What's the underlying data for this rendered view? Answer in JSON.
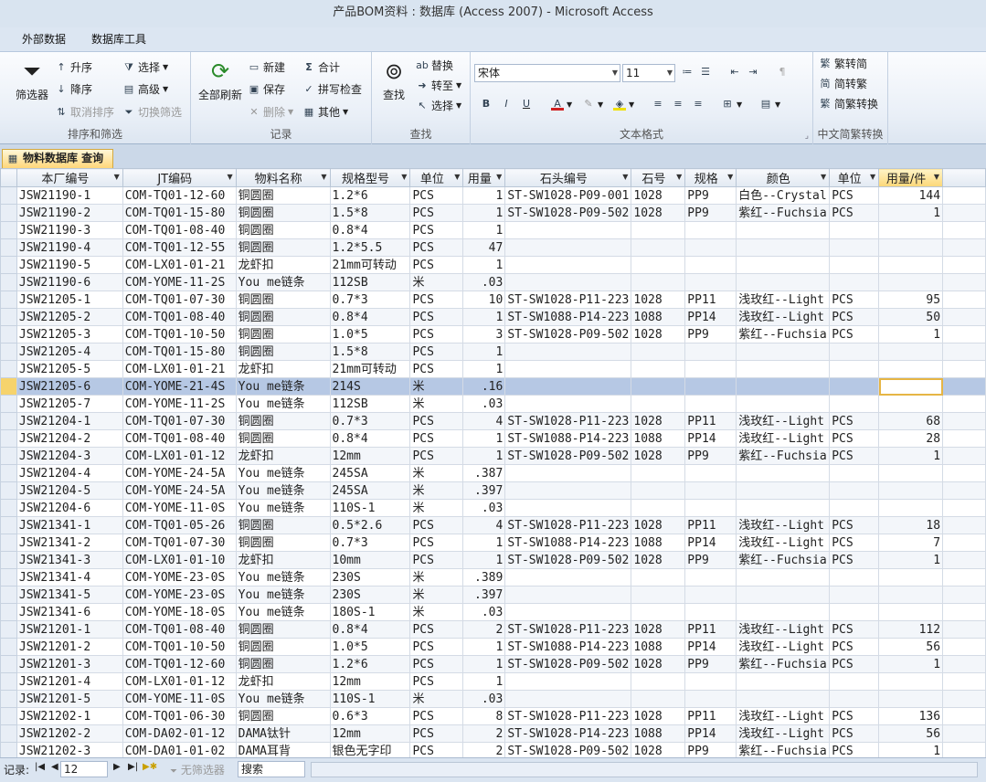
{
  "window": {
    "title": "产品BOM资料 : 数据库 (Access 2007)  -  Microsoft Access"
  },
  "ribbon_tabs": [
    "外部数据",
    "数据库工具"
  ],
  "ribbon": {
    "sort_filter": {
      "label": "排序和筛选",
      "filter": "筛选器",
      "asc": "升序",
      "desc": "降序",
      "clear_sort": "取消排序",
      "select": "选择",
      "advanced": "高级",
      "toggle_filter": "切换筛选"
    },
    "records": {
      "label": "记录",
      "refresh_all": "全部刷新",
      "new": "新建",
      "save": "保存",
      "delete": "删除",
      "totals": "合计",
      "spelling": "拼写检查",
      "more": "其他"
    },
    "find": {
      "label": "查找",
      "find": "查找",
      "replace": "替换",
      "goto": "转至",
      "select": "选择"
    },
    "text_format": {
      "label": "文本格式",
      "font": "宋体",
      "size": "11"
    },
    "chinese": {
      "label": "中文简繁转换",
      "t2s": "繁转简",
      "s2t": "简转繁",
      "convert": "简繁转换"
    }
  },
  "document_tab": {
    "label": "物料数据库 查询"
  },
  "columns": [
    "本厂编号",
    "JT编码",
    "物料名称",
    "规格型号",
    "单位",
    "用量",
    "石头编号",
    "石号",
    "规格",
    "颜色",
    "单位",
    "用量/件"
  ],
  "rows": [
    [
      "JSW21190-1",
      "COM-TQ01-12-60",
      "铜圆圈",
      "1.2*6",
      "PCS",
      "1",
      "ST-SW1028-P09-001",
      "1028",
      "PP9",
      "白色--Crystal",
      "PCS",
      "144"
    ],
    [
      "JSW21190-2",
      "COM-TQ01-15-80",
      "铜圆圈",
      "1.5*8",
      "PCS",
      "1",
      "ST-SW1028-P09-502",
      "1028",
      "PP9",
      "紫红--Fuchsia",
      "PCS",
      "1"
    ],
    [
      "JSW21190-3",
      "COM-TQ01-08-40",
      "铜圆圈",
      "0.8*4",
      "PCS",
      "1",
      "",
      "",
      "",
      "",
      "",
      ""
    ],
    [
      "JSW21190-4",
      "COM-TQ01-12-55",
      "铜圆圈",
      "1.2*5.5",
      "PCS",
      "47",
      "",
      "",
      "",
      "",
      "",
      ""
    ],
    [
      "JSW21190-5",
      "COM-LX01-01-21",
      "龙虾扣",
      "21mm可转动",
      "PCS",
      "1",
      "",
      "",
      "",
      "",
      "",
      ""
    ],
    [
      "JSW21190-6",
      "COM-YOME-11-2S",
      "You me链条",
      "112SB",
      "米",
      ".03",
      "",
      "",
      "",
      "",
      "",
      ""
    ],
    [
      "JSW21205-1",
      "COM-TQ01-07-30",
      "铜圆圈",
      "0.7*3",
      "PCS",
      "10",
      "ST-SW1028-P11-223",
      "1028",
      "PP11",
      "浅玫红--Light",
      "PCS",
      "95"
    ],
    [
      "JSW21205-2",
      "COM-TQ01-08-40",
      "铜圆圈",
      "0.8*4",
      "PCS",
      "1",
      "ST-SW1088-P14-223",
      "1088",
      "PP14",
      "浅玫红--Light",
      "PCS",
      "50"
    ],
    [
      "JSW21205-3",
      "COM-TQ01-10-50",
      "铜圆圈",
      "1.0*5",
      "PCS",
      "3",
      "ST-SW1028-P09-502",
      "1028",
      "PP9",
      "紫红--Fuchsia",
      "PCS",
      "1"
    ],
    [
      "JSW21205-4",
      "COM-TQ01-15-80",
      "铜圆圈",
      "1.5*8",
      "PCS",
      "1",
      "",
      "",
      "",
      "",
      "",
      ""
    ],
    [
      "JSW21205-5",
      "COM-LX01-01-21",
      "龙虾扣",
      "21mm可转动",
      "PCS",
      "1",
      "",
      "",
      "",
      "",
      "",
      ""
    ],
    [
      "JSW21205-6",
      "COM-YOME-21-4S",
      "You me链条",
      "214S",
      "米",
      ".16",
      "",
      "",
      "",
      "",
      "",
      ""
    ],
    [
      "JSW21205-7",
      "COM-YOME-11-2S",
      "You me链条",
      "112SB",
      "米",
      ".03",
      "",
      "",
      "",
      "",
      "",
      ""
    ],
    [
      "JSW21204-1",
      "COM-TQ01-07-30",
      "铜圆圈",
      "0.7*3",
      "PCS",
      "4",
      "ST-SW1028-P11-223",
      "1028",
      "PP11",
      "浅玫红--Light",
      "PCS",
      "68"
    ],
    [
      "JSW21204-2",
      "COM-TQ01-08-40",
      "铜圆圈",
      "0.8*4",
      "PCS",
      "1",
      "ST-SW1088-P14-223",
      "1088",
      "PP14",
      "浅玫红--Light",
      "PCS",
      "28"
    ],
    [
      "JSW21204-3",
      "COM-LX01-01-12",
      "龙虾扣",
      "12mm",
      "PCS",
      "1",
      "ST-SW1028-P09-502",
      "1028",
      "PP9",
      "紫红--Fuchsia",
      "PCS",
      "1"
    ],
    [
      "JSW21204-4",
      "COM-YOME-24-5A",
      "You me链条",
      "245SA",
      "米",
      ".387",
      "",
      "",
      "",
      "",
      "",
      ""
    ],
    [
      "JSW21204-5",
      "COM-YOME-24-5A",
      "You me链条",
      "245SA",
      "米",
      ".397",
      "",
      "",
      "",
      "",
      "",
      ""
    ],
    [
      "JSW21204-6",
      "COM-YOME-11-0S",
      "You me链条",
      "110S-1",
      "米",
      ".03",
      "",
      "",
      "",
      "",
      "",
      ""
    ],
    [
      "JSW21341-1",
      "COM-TQ01-05-26",
      "铜圆圈",
      "0.5*2.6",
      "PCS",
      "4",
      "ST-SW1028-P11-223",
      "1028",
      "PP11",
      "浅玫红--Light",
      "PCS",
      "18"
    ],
    [
      "JSW21341-2",
      "COM-TQ01-07-30",
      "铜圆圈",
      "0.7*3",
      "PCS",
      "1",
      "ST-SW1088-P14-223",
      "1088",
      "PP14",
      "浅玫红--Light",
      "PCS",
      "7"
    ],
    [
      "JSW21341-3",
      "COM-LX01-01-10",
      "龙虾扣",
      "10mm",
      "PCS",
      "1",
      "ST-SW1028-P09-502",
      "1028",
      "PP9",
      "紫红--Fuchsia",
      "PCS",
      "1"
    ],
    [
      "JSW21341-4",
      "COM-YOME-23-0S",
      "You me链条",
      "230S",
      "米",
      ".389",
      "",
      "",
      "",
      "",
      "",
      ""
    ],
    [
      "JSW21341-5",
      "COM-YOME-23-0S",
      "You me链条",
      "230S",
      "米",
      ".397",
      "",
      "",
      "",
      "",
      "",
      ""
    ],
    [
      "JSW21341-6",
      "COM-YOME-18-0S",
      "You me链条",
      "180S-1",
      "米",
      ".03",
      "",
      "",
      "",
      "",
      "",
      ""
    ],
    [
      "JSW21201-1",
      "COM-TQ01-08-40",
      "铜圆圈",
      "0.8*4",
      "PCS",
      "2",
      "ST-SW1028-P11-223",
      "1028",
      "PP11",
      "浅玫红--Light",
      "PCS",
      "112"
    ],
    [
      "JSW21201-2",
      "COM-TQ01-10-50",
      "铜圆圈",
      "1.0*5",
      "PCS",
      "1",
      "ST-SW1088-P14-223",
      "1088",
      "PP14",
      "浅玫红--Light",
      "PCS",
      "56"
    ],
    [
      "JSW21201-3",
      "COM-TQ01-12-60",
      "铜圆圈",
      "1.2*6",
      "PCS",
      "1",
      "ST-SW1028-P09-502",
      "1028",
      "PP9",
      "紫红--Fuchsia",
      "PCS",
      "1"
    ],
    [
      "JSW21201-4",
      "COM-LX01-01-12",
      "龙虾扣",
      "12mm",
      "PCS",
      "1",
      "",
      "",
      "",
      "",
      "",
      ""
    ],
    [
      "JSW21201-5",
      "COM-YOME-11-0S",
      "You me链条",
      "110S-1",
      "米",
      ".03",
      "",
      "",
      "",
      "",
      "",
      ""
    ],
    [
      "JSW21202-1",
      "COM-TQ01-06-30",
      "铜圆圈",
      "0.6*3",
      "PCS",
      "8",
      "ST-SW1028-P11-223",
      "1028",
      "PP11",
      "浅玫红--Light",
      "PCS",
      "136"
    ],
    [
      "JSW21202-2",
      "COM-DA02-01-12",
      "DAMA钛针",
      "12mm",
      "PCS",
      "2",
      "ST-SW1028-P14-223",
      "1088",
      "PP14",
      "浅玫红--Light",
      "PCS",
      "56"
    ],
    [
      "JSW21202-3",
      "COM-DA01-01-02",
      "DAMA耳背",
      "银色无字印",
      "PCS",
      "2",
      "ST-SW1028-P09-502",
      "1028",
      "PP9",
      "紫红--Fuchsia",
      "PCS",
      "1"
    ]
  ],
  "current_row_index": 11,
  "navigation": {
    "record_label": "记录:",
    "current": "12",
    "no_filter": "无筛选器",
    "search": "搜索"
  }
}
